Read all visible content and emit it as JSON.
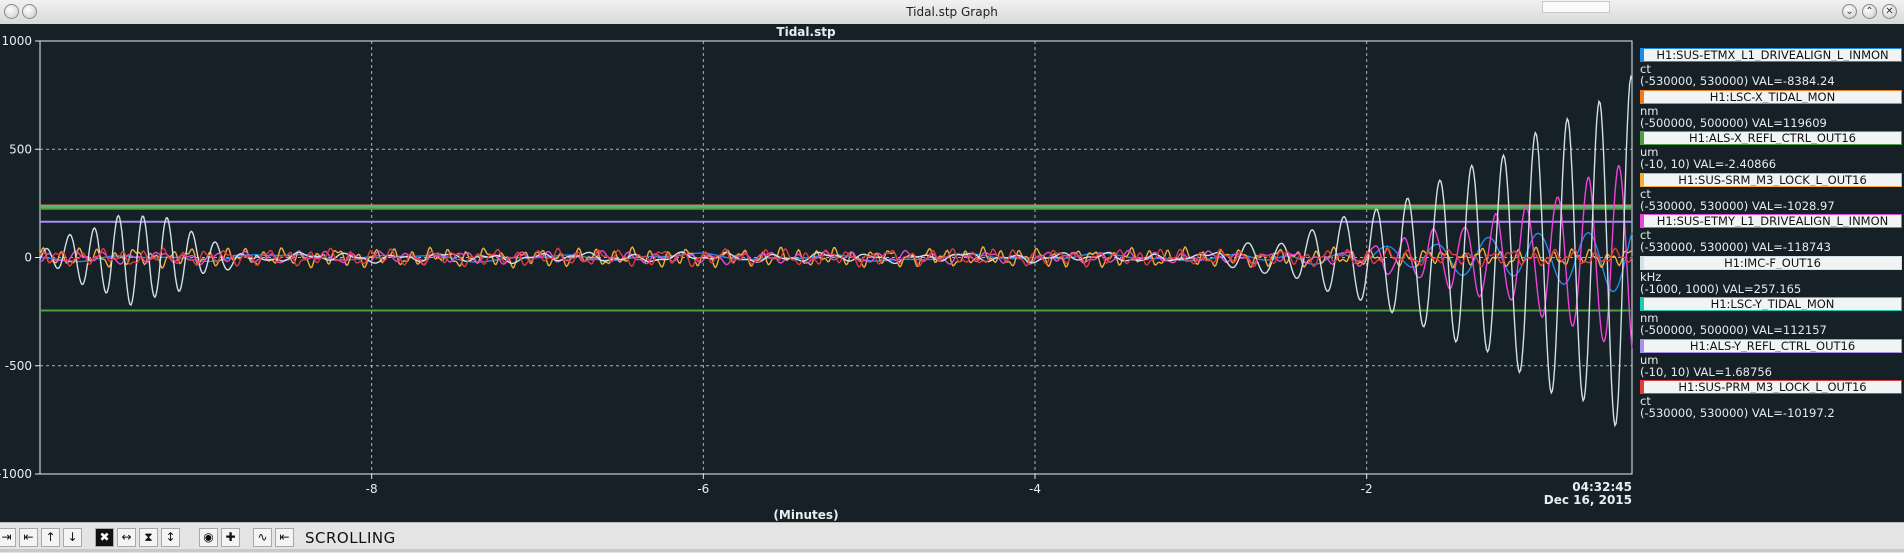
{
  "window": {
    "title": "Tidal.stp Graph"
  },
  "chart_data": {
    "type": "line",
    "title": "Tidal.stp",
    "xlabel": "(Minutes)",
    "ylabel": "",
    "xlim": [
      -10.0,
      -0.4
    ],
    "ylim": [
      -1000,
      1000
    ],
    "x_ticks": [
      -8,
      -6,
      -4,
      -2
    ],
    "x_tick_labels": [
      "-8",
      "-6",
      "-4",
      "-2"
    ],
    "y_ticks": [
      -1000,
      -500,
      0,
      500,
      1000
    ],
    "y_tick_labels": [
      "-1000",
      "-500",
      "0",
      "500",
      "1000"
    ],
    "grid": true,
    "time_label": "04:32:45",
    "date_label": "Dec 16, 2015",
    "legend_position": "right",
    "hlines": [
      {
        "value": 240,
        "color": "#f07a1e"
      },
      {
        "value": 232,
        "color": "#1fc9b2"
      },
      {
        "value": 225,
        "color": "#4fa040"
      },
      {
        "value": 165,
        "color": "#a98ff0"
      },
      {
        "value": -245,
        "color": "#4fa040"
      }
    ],
    "series": [
      {
        "name": "H1:SUS-ETMX_L1_DRIVEALIGN_L_INMON",
        "color": "#1e8be6",
        "unit": "ct",
        "range": "(-530000, 530000)",
        "val": "VAL=-8384.24",
        "kind": "low",
        "amp": 20,
        "freq": 1.2,
        "seed": 1,
        "env_start": -3.0,
        "env_amp": 160,
        "env_freq": 3.3
      },
      {
        "name": "H1:LSC-X_TIDAL_MON",
        "color": "#f07a1e",
        "unit": "nm",
        "range": "(-500000, 500000)",
        "val": "VAL=119609",
        "kind": "flat"
      },
      {
        "name": "H1:ALS-X_REFL_CTRL_OUT16",
        "color": "#4fa040",
        "unit": "um",
        "range": "(-10, 10)",
        "val": "VAL=-2.40866",
        "kind": "flat"
      },
      {
        "name": "H1:SUS-SRM_M3_LOCK_L_OUT16",
        "color": "#f2ad35",
        "unit": "ct",
        "range": "(-530000, 530000)",
        "val": "VAL=-1028.97",
        "kind": "noise",
        "amp": 45,
        "freq": 9.0,
        "seed": 4
      },
      {
        "name": "H1:SUS-ETMY_L1_DRIVEALIGN_L_INMON",
        "color": "#ec44d8",
        "unit": "ct",
        "range": "(-530000, 530000)",
        "val": "VAL=-118743",
        "kind": "noise",
        "amp": 30,
        "freq": 6.0,
        "seed": 5,
        "env_start": -2.4,
        "env_amp": 460,
        "env_freq": 5.4
      },
      {
        "name": "H1:IMC-F_OUT16",
        "color": "#d2e0e6",
        "unit": "kHz",
        "range": "(-1000, 1000)",
        "val": "VAL=257.165",
        "kind": "noise",
        "amp": 25,
        "freq": 3.5,
        "seed": 6,
        "env_start": -3.2,
        "env_amp": 820,
        "env_freq": 5.2,
        "start_burst": 200
      },
      {
        "name": "H1:LSC-Y_TIDAL_MON",
        "color": "#1fc9b2",
        "unit": "nm",
        "range": "(-500000, 500000)",
        "val": "VAL=112157",
        "kind": "flat"
      },
      {
        "name": "H1:ALS-Y_REFL_CTRL_OUT16",
        "color": "#a98ff0",
        "unit": "um",
        "range": "(-10, 10)",
        "val": "VAL=1.68756",
        "kind": "flat"
      },
      {
        "name": "H1:SUS-PRM_M3_LOCK_L_OUT16",
        "color": "#e33b3b",
        "unit": "ct",
        "range": "(-530000, 530000)",
        "val": "VAL=-10197.2",
        "kind": "noise",
        "amp": 40,
        "freq": 8.0,
        "seed": 9
      }
    ]
  },
  "toolbar": {
    "status": "SCROLLING",
    "icons": [
      "arrow-right-icon",
      "arrow-left-icon",
      "arrow-up-icon",
      "arrow-down-icon",
      "zoom-xy-icon",
      "zoom-x-icon",
      "zoom-y-icon",
      "zoom-y-alt-icon",
      "circle-icon",
      "plus-icon",
      "autoscale-icon",
      "back-icon"
    ]
  }
}
